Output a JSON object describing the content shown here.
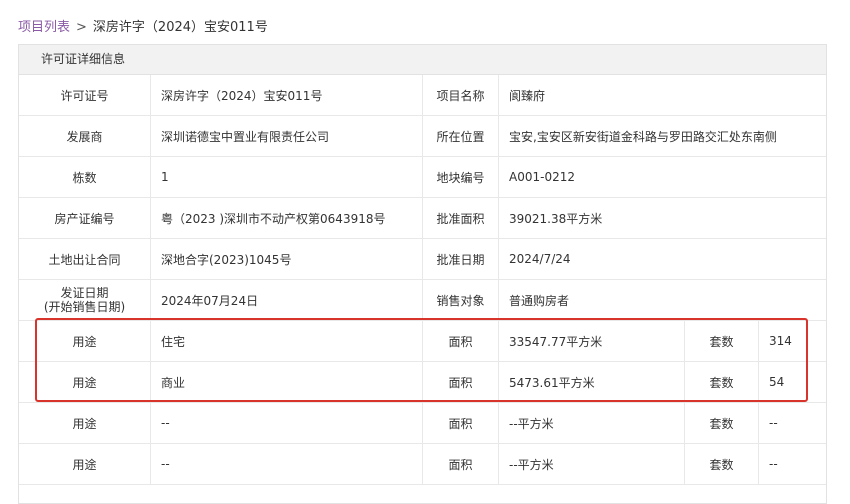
{
  "breadcrumb": {
    "root": "项目列表",
    "separator": ">",
    "current": "深房许字（2024）宝安011号"
  },
  "panel": {
    "title": "许可证详细信息"
  },
  "info_rows": [
    {
      "label1": "许可证号",
      "value1": "深房许字（2024）宝安011号",
      "label2": "项目名称",
      "value2": "阆臻府"
    },
    {
      "label1": "发展商",
      "value1": "深圳诺德宝中置业有限责任公司",
      "label2": "所在位置",
      "value2": "宝安,宝安区新安街道金科路与罗田路交汇处东南侧"
    },
    {
      "label1": "栋数",
      "value1": "1",
      "label2": "地块编号",
      "value2": "A001-0212"
    },
    {
      "label1": "房产证编号",
      "value1": "粤（2023 )深圳市不动产权第0643918号",
      "label2": "批准面积",
      "value2": "39021.38平方米"
    },
    {
      "label1": "土地出让合同",
      "value1": "深地合字(2023)1045号",
      "label2": "批准日期",
      "value2": "2024/7/24"
    },
    {
      "label1_line1": "发证日期",
      "label1_line2": "(开始销售日期)",
      "value1": "2024年07月24日",
      "label2": "销售对象",
      "value2": "普通购房者"
    }
  ],
  "usage_rows": [
    {
      "label": "用途",
      "usage": "住宅",
      "area_label": "面积",
      "area": "33547.77平方米",
      "count_label": "套数",
      "count": "314"
    },
    {
      "label": "用途",
      "usage": "商业",
      "area_label": "面积",
      "area": "5473.61平方米",
      "count_label": "套数",
      "count": "54"
    },
    {
      "label": "用途",
      "usage": "--",
      "area_label": "面积",
      "area": "--平方米",
      "count_label": "套数",
      "count": "--"
    },
    {
      "label": "用途",
      "usage": "--",
      "area_label": "面积",
      "area": "--平方米",
      "count_label": "套数",
      "count": "--"
    }
  ],
  "colors": {
    "breadcrumb_link": "#8a5aa6",
    "highlight_border": "#d9342b",
    "header_bg": "#f2f2f2"
  }
}
